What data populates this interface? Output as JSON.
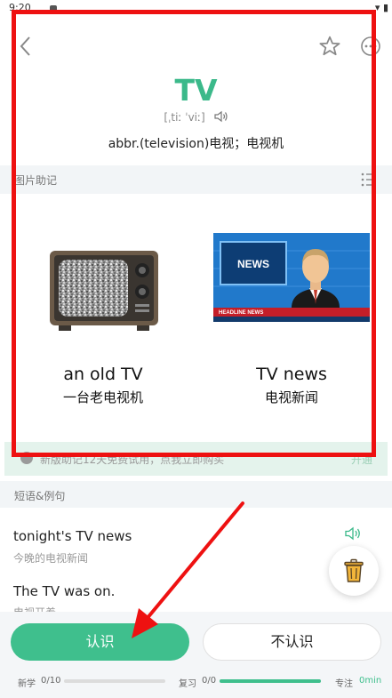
{
  "status": {
    "time": "9:20",
    "sys": "▾ ▮"
  },
  "word": {
    "headword": "TV",
    "phonetic": "[ˌtiː ˈviː]",
    "definition": "abbr.(television)电视；电视机"
  },
  "image_section": {
    "title": "图片助记"
  },
  "cards": [
    {
      "en": "an old TV",
      "zh": "一台老电视机"
    },
    {
      "en": "TV news",
      "zh": "电视新闻",
      "news_label": "NEWS",
      "ticker": "HEADLINE NEWS"
    }
  ],
  "promo": {
    "text": "新版助记12天免费试用，点我立即购买",
    "button": "开通"
  },
  "phrase_section": {
    "title": "短语&例句"
  },
  "examples": [
    {
      "en": "tonight's TV news",
      "zh": "今晚的电视新闻"
    },
    {
      "en": "The TV was on.",
      "zh": "电视开着"
    }
  ],
  "actions": {
    "know": "认识",
    "dont_know": "不认识"
  },
  "progress": {
    "new_label": "新学",
    "new_value": "0/10",
    "new_fraction": 0,
    "review_label": "复习",
    "review_value": "0/0",
    "review_fraction": 1,
    "focus_label": "专注",
    "focus_value": "0min"
  },
  "colors": {
    "accent": "#3bb98a",
    "annotation": "#ee1111"
  }
}
